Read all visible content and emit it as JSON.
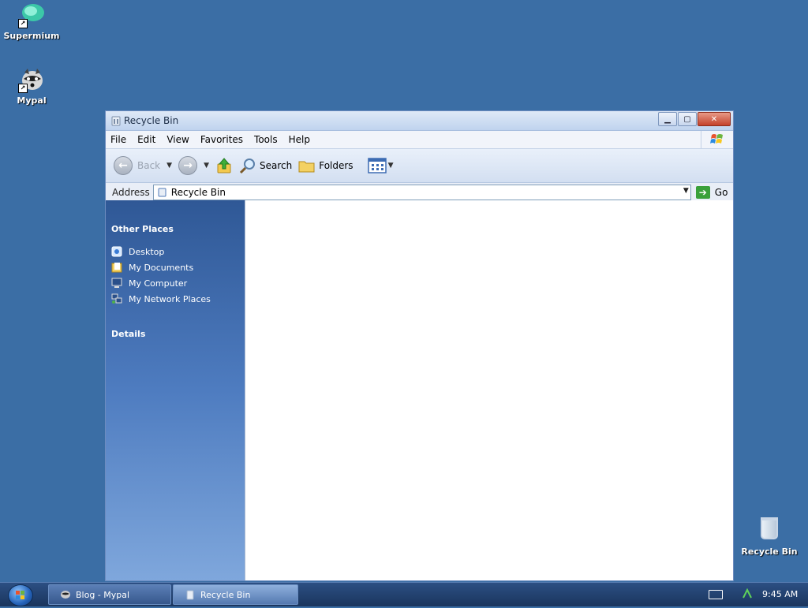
{
  "desktop": {
    "icons": [
      {
        "label": "Supermium"
      },
      {
        "label": "Mypal"
      },
      {
        "label": "Recycle Bin"
      }
    ]
  },
  "window": {
    "title": "Recycle Bin",
    "menu": [
      "File",
      "Edit",
      "View",
      "Favorites",
      "Tools",
      "Help"
    ],
    "toolbar": {
      "back": "Back",
      "search": "Search",
      "folders": "Folders"
    },
    "address": {
      "label": "Address",
      "value": "Recycle Bin",
      "go": "Go"
    },
    "sidepane": {
      "other_places_title": "Other Places",
      "places": [
        "Desktop",
        "My Documents",
        "My Computer",
        "My Network Places"
      ],
      "details_title": "Details"
    }
  },
  "taskbar": {
    "tasks": [
      "Blog - Mypal",
      "Recycle Bin"
    ],
    "clock": "9:45 AM"
  }
}
